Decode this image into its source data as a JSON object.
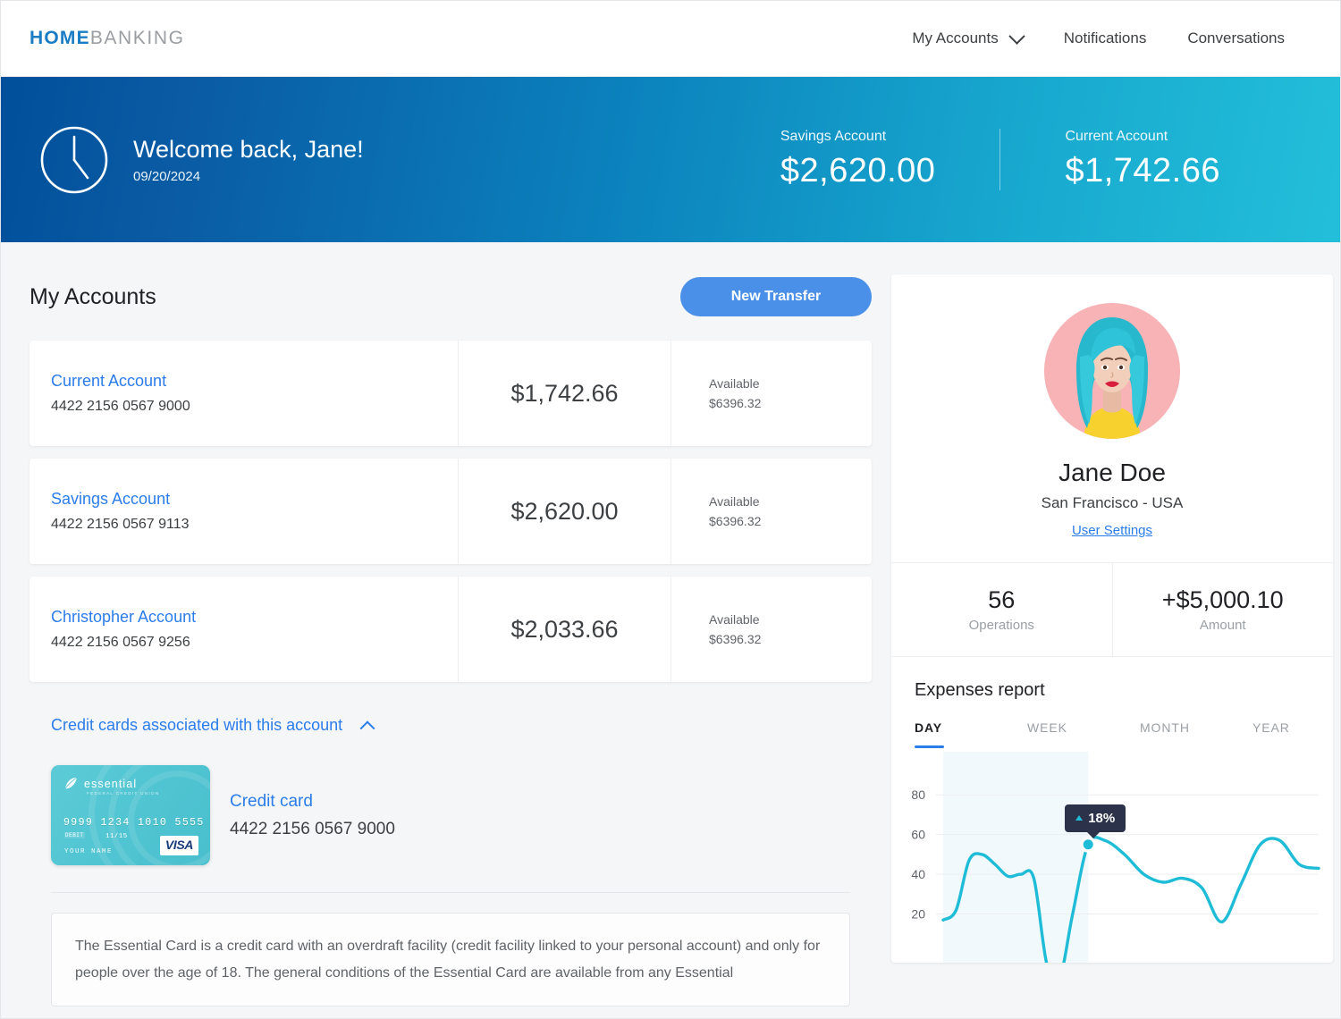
{
  "header": {
    "logo_primary": "HOME",
    "logo_secondary": "BANKING",
    "nav": [
      {
        "label": "My Accounts",
        "icon": "chevron-down-icon"
      },
      {
        "label": "Notifications",
        "icon": ""
      },
      {
        "label": "Conversations",
        "icon": ""
      }
    ]
  },
  "hero": {
    "icon": "clock-icon",
    "greeting": "Welcome back, Jane!",
    "date": "09/20/2024",
    "summaries": [
      {
        "label": "Savings Account",
        "value": "$2,620.00"
      },
      {
        "label": "Current Account",
        "value": "$1,742.66"
      }
    ],
    "gradient_from": "#004f9b",
    "gradient_to": "#23bfda"
  },
  "accounts_section": {
    "title": "My Accounts",
    "new_transfer_label": "New Transfer",
    "accent_color": "#4a90e8",
    "rows": [
      {
        "name": "Current Account",
        "number": "4422 2156 0567 9000",
        "balance": "$1,742.66",
        "available_label": "Available",
        "available_value": "$6396.32"
      },
      {
        "name": "Savings Account",
        "number": "4422 2156 0567 9113",
        "balance": "$2,620.00",
        "available_label": "Available",
        "available_value": "$6396.32"
      },
      {
        "name": "Christopher Account",
        "number": "4422 2156 0567 9256",
        "balance": "$2,033.66",
        "available_label": "Available",
        "available_value": "$6396.32"
      }
    ]
  },
  "credit_cards": {
    "toggle_label": "Credit cards associated with this account",
    "toggle_icon": "chevron-up-icon",
    "card": {
      "brand": "essential",
      "brand_sub": "FEDERAL CREDIT UNION",
      "number_on_card": "9999 1234 1010 5555",
      "chip_label": "DEBIT",
      "expiry": "11/15",
      "holder": "YOUR NAME",
      "network": "VISA",
      "card_color": "#53c6d3"
    },
    "label": "Credit card",
    "number": "4422 2156 0567 9000",
    "disclaimer": "The Essential Card is a credit card with an overdraft facility (credit facility linked to your personal account) and only for people over the age of 18. The general conditions of the Essential Card are available from any Essential"
  },
  "profile": {
    "avatar": "user-avatar-photo",
    "name": "Jane Doe",
    "location": "San Francisco - USA",
    "settings_link": "User Settings",
    "stats": [
      {
        "value": "56",
        "label": "Operations"
      },
      {
        "value": "+$5,000.10",
        "label": "Amount"
      }
    ]
  },
  "expenses_report": {
    "title": "Expenses report",
    "tabs": [
      {
        "label": "DAY",
        "active": true
      },
      {
        "label": "WEEK",
        "active": false
      },
      {
        "label": "MONTH",
        "active": false
      },
      {
        "label": "YEAR",
        "active": false
      }
    ],
    "tooltip": {
      "value": "18%",
      "direction": "up"
    }
  },
  "chart_data": {
    "type": "line",
    "title": "Expenses report",
    "xlabel": "",
    "ylabel": "",
    "ylim": [
      0,
      90
    ],
    "yticks": [
      20,
      40,
      60,
      80
    ],
    "grid": true,
    "legend": "none",
    "line_color": "#1fbcd8",
    "highlight_band": {
      "from_x": 0,
      "to_x": 11.2,
      "color": "#f2f9fd"
    },
    "marker": {
      "x": 11.2,
      "y": 55,
      "label": "18%"
    },
    "x": [
      0,
      1,
      2,
      3,
      4,
      5,
      6,
      7,
      8,
      9,
      10,
      11.2,
      12.5,
      14,
      15.5,
      17,
      18.5,
      20,
      21.5,
      23,
      24.5,
      26,
      27.5,
      29
    ],
    "y": [
      17,
      22,
      47,
      50,
      45,
      39,
      40,
      38,
      -5,
      -12,
      20,
      55,
      57,
      50,
      40,
      36,
      38,
      33,
      16,
      35,
      55,
      57,
      45,
      43,
      52
    ]
  }
}
